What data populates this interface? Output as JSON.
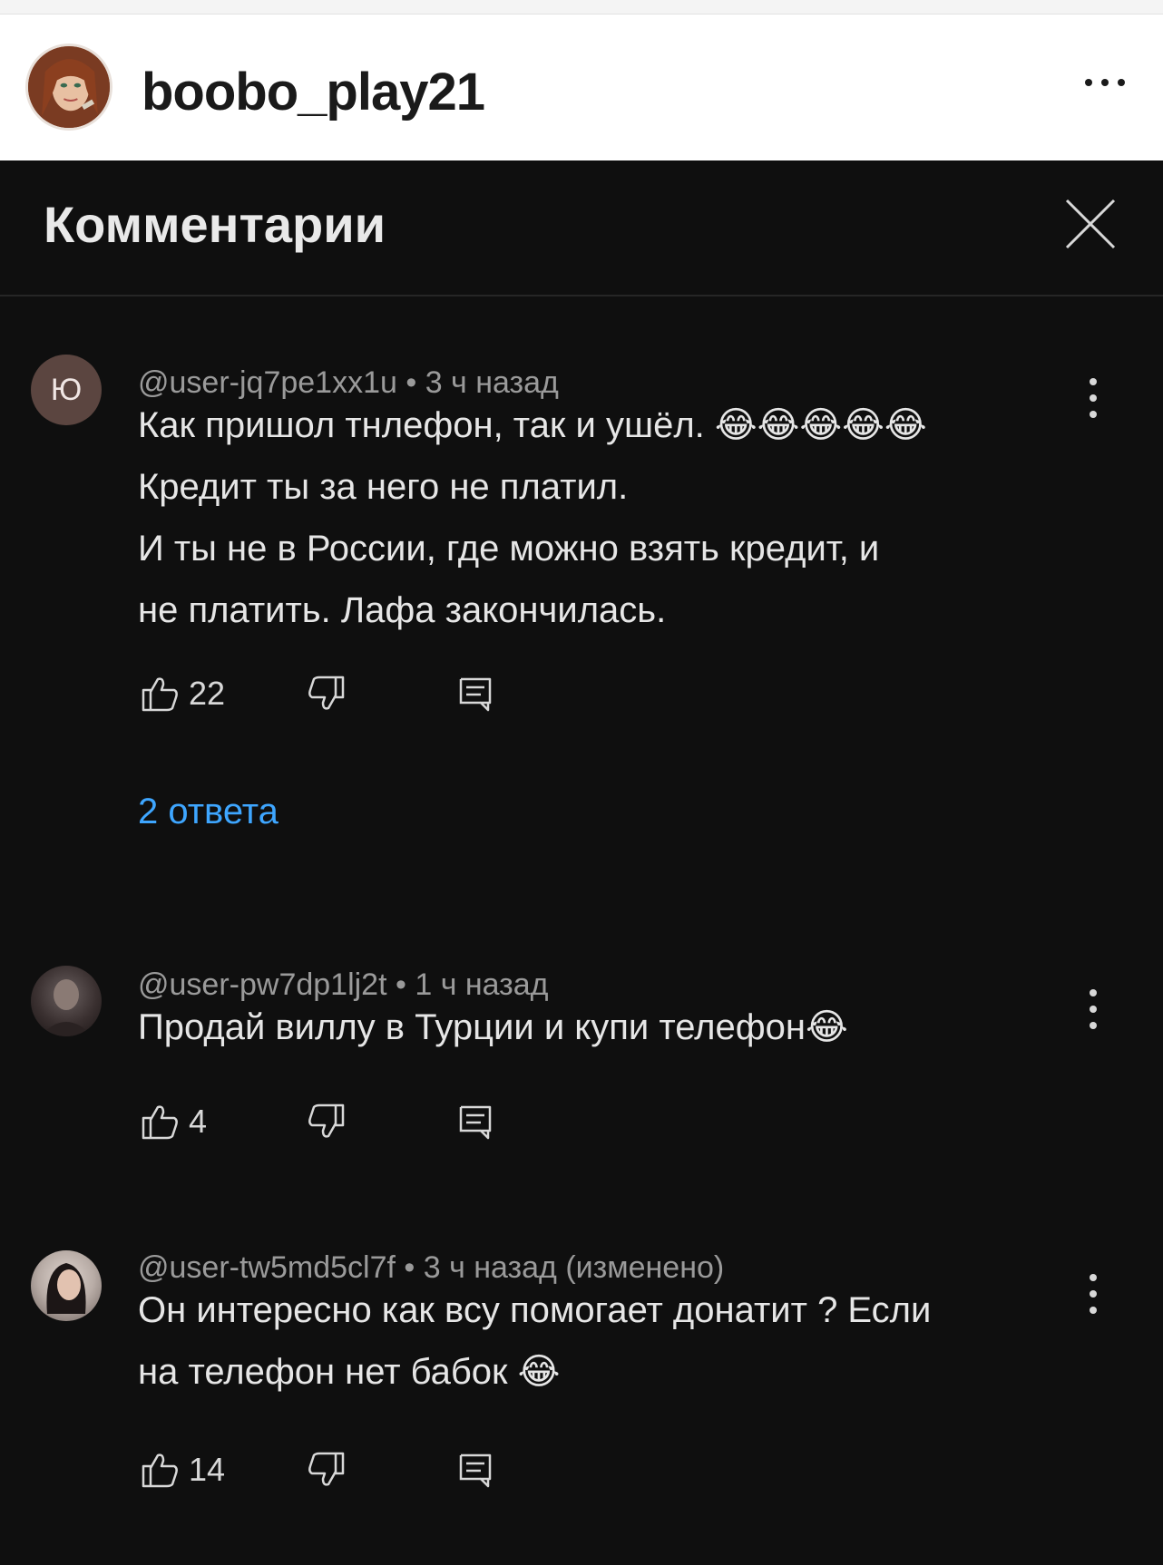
{
  "post": {
    "username": "boobo_play21"
  },
  "comments_panel": {
    "title": "Комментарии"
  },
  "comments": [
    {
      "avatar_letter": "Ю",
      "meta": "@user-jq7pe1xx1u • 3 ч назад",
      "lines": [
        "Как пришол тнлефон, так и ушёл. 😂😂😂😂😂",
        "Кредит ты за него не платил.",
        "И ты не в России, где можно взять кредит, и",
        "не платить. Лафа закончилась."
      ],
      "likes": "22",
      "replies_label": "2 ответа"
    },
    {
      "meta": "@user-pw7dp1lj2t • 1 ч назад",
      "lines": [
        "Продай виллу в Турции и купи телефон😂"
      ],
      "likes": "4"
    },
    {
      "meta": "@user-tw5md5cl7f • 3 ч назад (изменено)",
      "lines": [
        "Он интересно как всу помогает донатит ? Если",
        "на телефон нет бабок 😂"
      ],
      "likes": "14"
    }
  ],
  "colors": {
    "background_dark": "#0f0f0f",
    "text_primary": "#e6e6e6",
    "text_secondary": "#9a9a9a",
    "link_blue": "#3ea6ff"
  },
  "icons": {
    "post_more": "more-horizontal-icon",
    "close": "close-icon",
    "like": "thumbs-up-icon",
    "dislike": "thumbs-down-icon",
    "reply": "reply-comment-icon",
    "comment_menu": "more-vertical-icon"
  }
}
